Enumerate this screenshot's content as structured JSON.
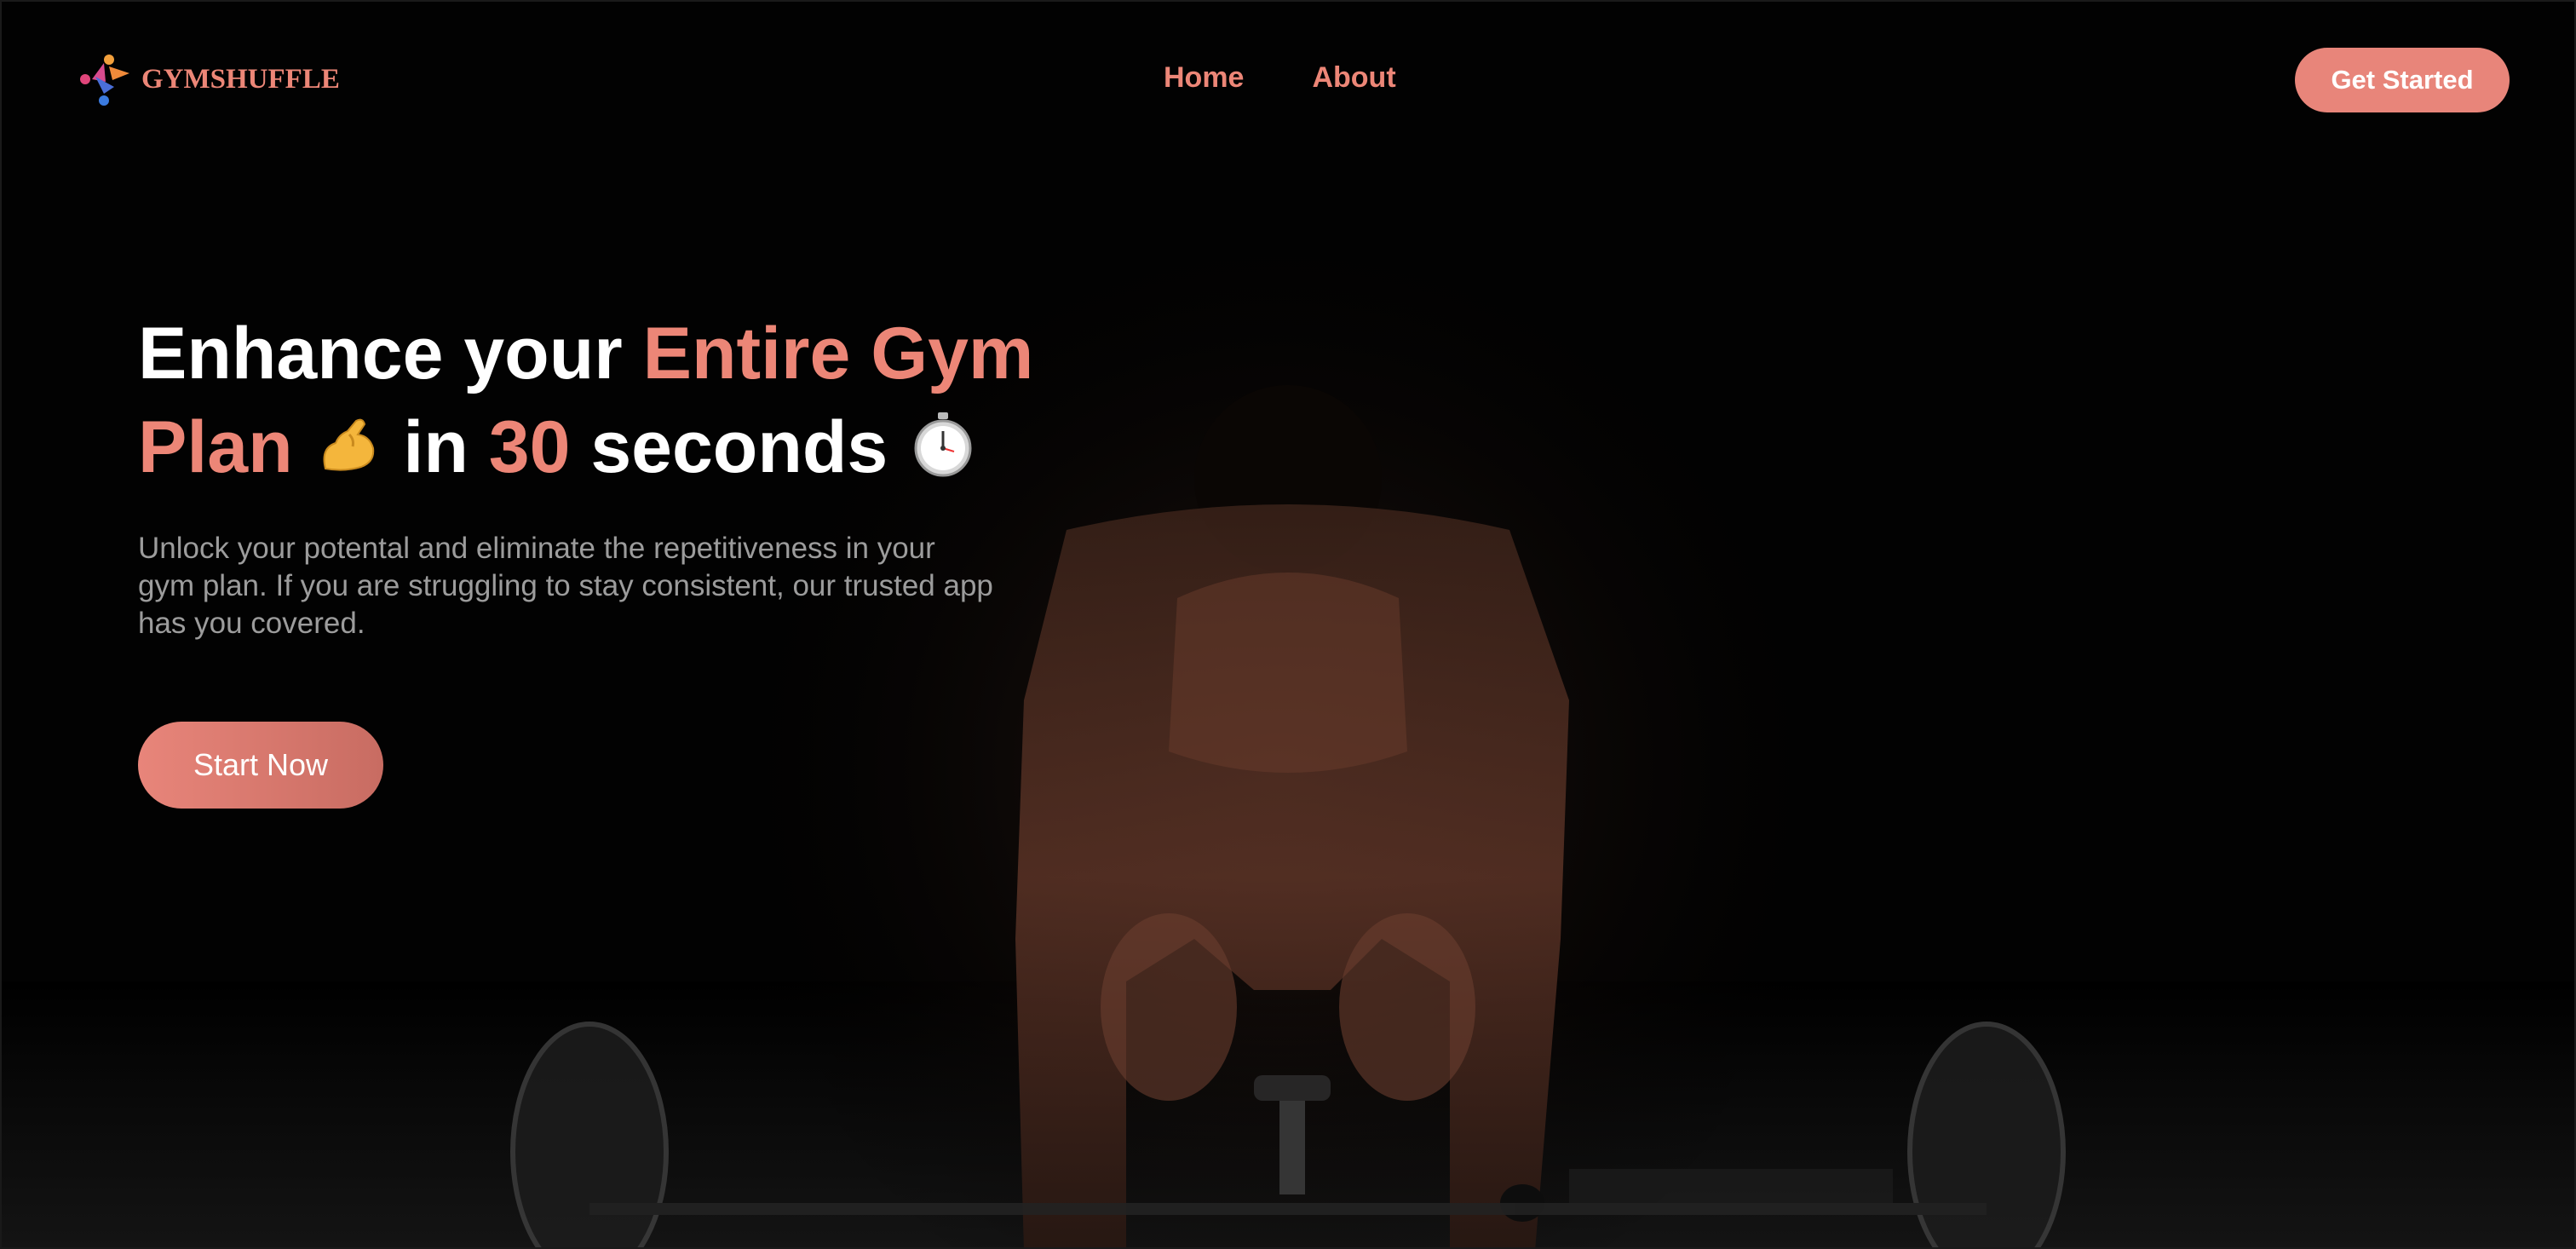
{
  "brand": {
    "name": "GYMSHUFFLE",
    "accent_color": "#ec8677"
  },
  "nav": {
    "links": [
      {
        "label": "Home"
      },
      {
        "label": "About"
      }
    ],
    "cta_label": "Get Started"
  },
  "hero": {
    "headline": {
      "part1": "Enhance your ",
      "part2": "Entire Gym Plan",
      "emoji1": "flexed-biceps-icon",
      "part3": " in ",
      "part4": "30",
      "part5": " seconds",
      "emoji2": "stopwatch-icon"
    },
    "subtext": "Unlock your potental and eliminate the repetitiveness in your gym plan. If you are struggling to stay consistent, our trusted app has you covered.",
    "cta_label": "Start Now",
    "image": "man-lifting-barbell-photo"
  }
}
